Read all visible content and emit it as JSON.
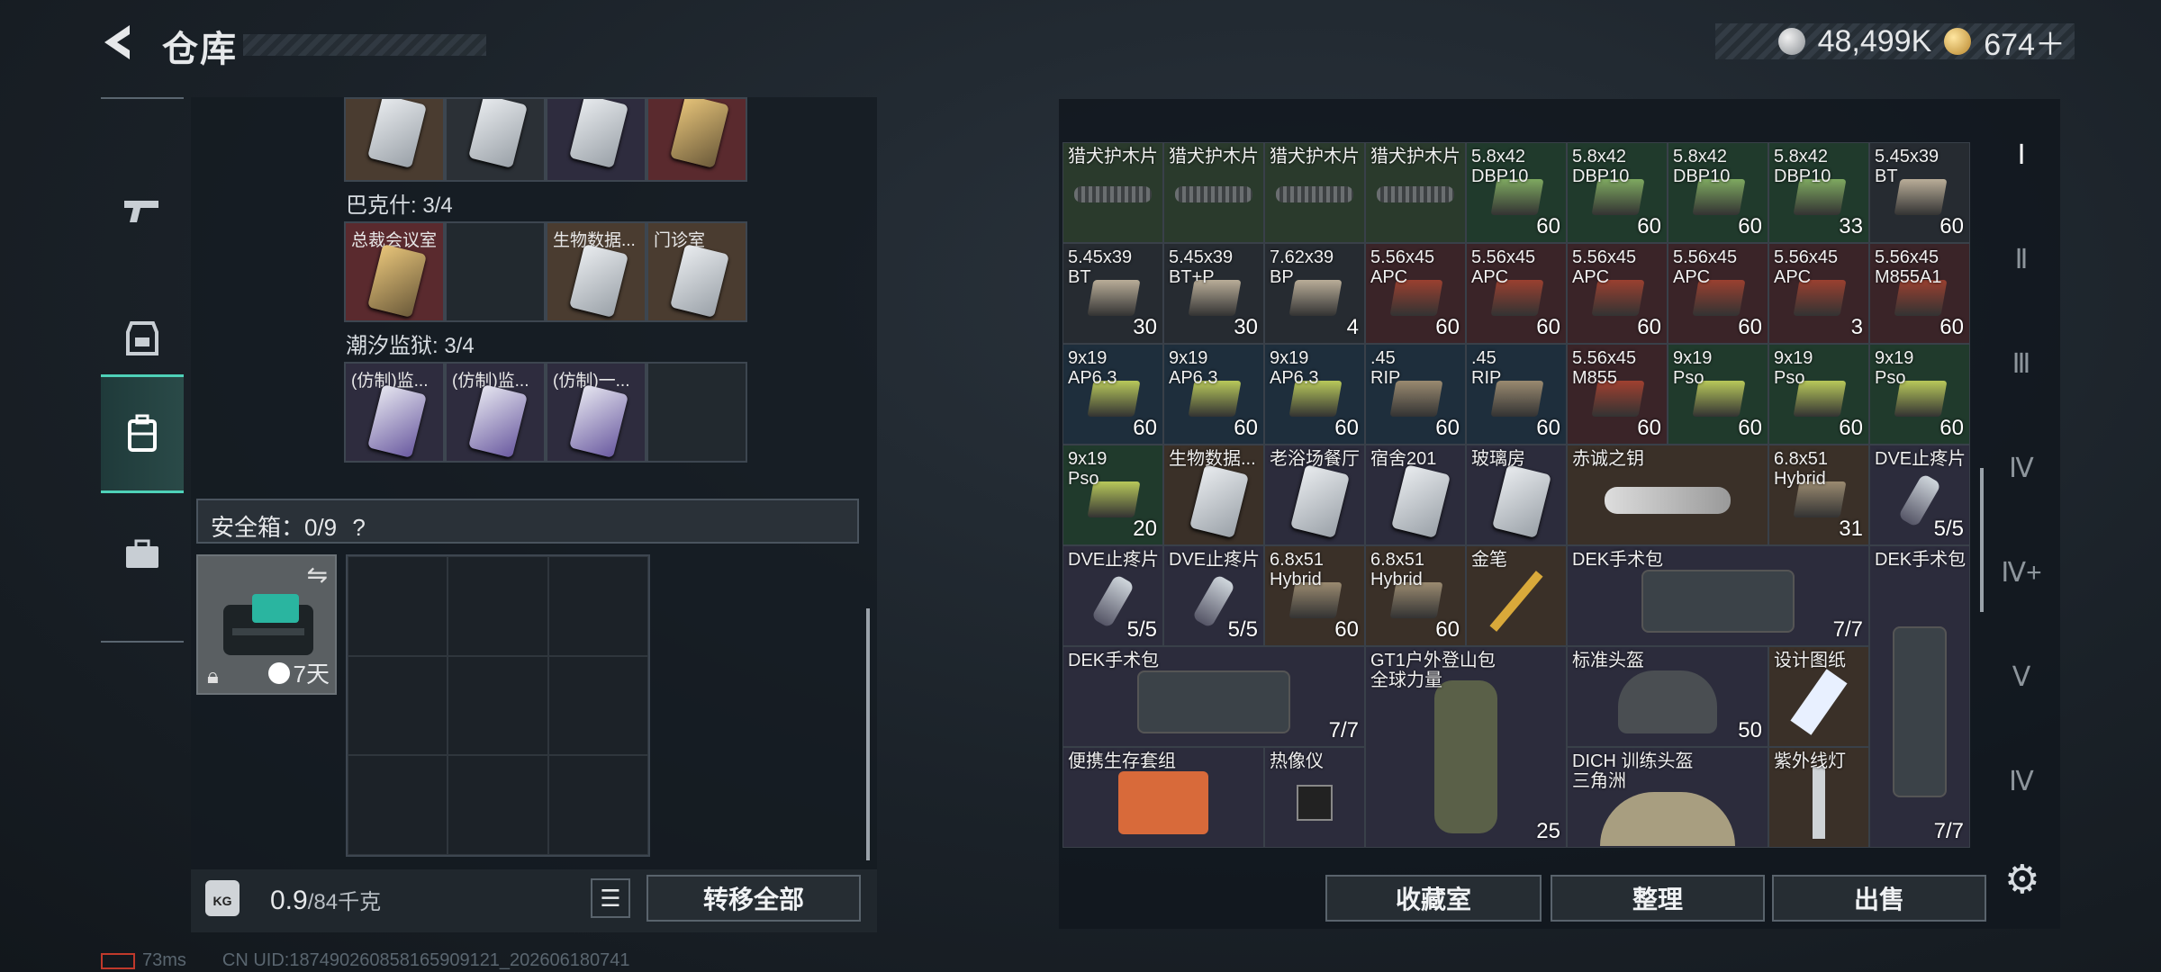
{
  "header": {
    "title": "仓库",
    "silver": "48,499K",
    "gold": "674＋"
  },
  "side_tabs": [
    {
      "name": "weapon-icon",
      "glyph": "⌐"
    },
    {
      "name": "armor-icon",
      "glyph": "⛨"
    },
    {
      "name": "backpack-icon",
      "glyph": "▤"
    },
    {
      "name": "toolbox-icon",
      "glyph": "⧉"
    }
  ],
  "left": {
    "section_bakeshi": "巴克什: 3/4",
    "section_prison": "潮汐监狱: 3/4",
    "row2": [
      "总裁会议室",
      "",
      "生物数据...",
      "门诊室"
    ],
    "row3": [
      "(仿制)监...",
      "(仿制)监...",
      "(仿制)一...",
      ""
    ],
    "safe_label": "安全箱：0/9",
    "safe_help": "?",
    "safe_timer": "7天",
    "weight": "0.9",
    "weight_max": "/84千克",
    "kg_icon": "KG",
    "transfer_all": "转移全部"
  },
  "inventory": {
    "row1": [
      {
        "n": "猎犬护木片",
        "c": ""
      },
      {
        "n": "猎犬护木片",
        "c": ""
      },
      {
        "n": "猎犬护木片",
        "c": ""
      },
      {
        "n": "猎犬护木片",
        "c": ""
      },
      {
        "n": "5.8x42\nDBP10",
        "c": "60"
      },
      {
        "n": "5.8x42\nDBP10",
        "c": "60"
      },
      {
        "n": "5.8x42\nDBP10",
        "c": "60"
      },
      {
        "n": "5.8x42\nDBP10",
        "c": "33"
      },
      {
        "n": "5.45x39\nBT",
        "c": "60"
      }
    ],
    "row2": [
      {
        "n": "5.45x39\nBT",
        "c": "30"
      },
      {
        "n": "5.45x39\nBT+P",
        "c": "30"
      },
      {
        "n": "7.62x39\nBP",
        "c": "4"
      },
      {
        "n": "5.56x45\nAPC",
        "c": "60"
      },
      {
        "n": "5.56x45\nAPC",
        "c": "60"
      },
      {
        "n": "5.56x45\nAPC",
        "c": "60"
      },
      {
        "n": "5.56x45\nAPC",
        "c": "60"
      },
      {
        "n": "5.56x45\nAPC",
        "c": "3"
      },
      {
        "n": "5.56x45\nM855A1",
        "c": "60"
      }
    ],
    "row3": [
      {
        "n": "9x19\nAP6.3",
        "c": "60"
      },
      {
        "n": "9x19\nAP6.3",
        "c": "60"
      },
      {
        "n": "9x19\nAP6.3",
        "c": "60"
      },
      {
        "n": ".45\nRIP",
        "c": "60"
      },
      {
        "n": ".45\nRIP",
        "c": "60"
      },
      {
        "n": "5.56x45\nM855",
        "c": "60"
      },
      {
        "n": "9x19\nPso",
        "c": "60"
      },
      {
        "n": "9x19\nPso",
        "c": "60"
      },
      {
        "n": "9x19\nPso",
        "c": "60"
      }
    ],
    "row4": [
      {
        "n": "9x19\nPso",
        "c": "20"
      },
      {
        "n": "生物数据...",
        "c": ""
      },
      {
        "n": "老浴场餐厅",
        "c": ""
      },
      {
        "n": "宿舍201",
        "c": ""
      },
      {
        "n": "玻璃房",
        "c": ""
      },
      {
        "n": "赤诚之钥",
        "c": ""
      },
      {
        "n": "6.8x51\nHybrid",
        "c": "31"
      },
      {
        "n": "DVE止疼片",
        "c": "5/5"
      }
    ],
    "row5": [
      {
        "n": "DVE止疼片",
        "c": "5/5"
      },
      {
        "n": "DVE止疼片",
        "c": "5/5"
      },
      {
        "n": "6.8x51\nHybrid",
        "c": "60"
      },
      {
        "n": "6.8x51\nHybrid",
        "c": "60"
      },
      {
        "n": "金笔",
        "c": ""
      },
      {
        "n": "DEK手术包",
        "c": "7/7"
      },
      {
        "n": "DEK手术包",
        "c": "7/7"
      }
    ],
    "row6": [
      {
        "n": "DEK手术包",
        "c": "7/7"
      },
      {
        "n": "GT1户外登山包\n全球力量",
        "c": "25"
      },
      {
        "n": "标准头盔",
        "c": "50"
      },
      {
        "n": "设计图纸",
        "c": ""
      }
    ],
    "row7": [
      {
        "n": "便携生存套组",
        "c": ""
      },
      {
        "n": "热像仪",
        "c": ""
      },
      {
        "n": "DICH 训练头盔\n三角洲",
        "c": ""
      },
      {
        "n": "紫外线灯",
        "c": ""
      }
    ]
  },
  "actions": {
    "collection": "收藏室",
    "sort": "整理",
    "sell": "出售"
  },
  "right_tabs": [
    "Ⅰ",
    "Ⅱ",
    "Ⅲ",
    "Ⅳ",
    "Ⅳ+",
    "Ⅴ",
    "Ⅳ"
  ],
  "status": {
    "ping": "73ms",
    "uid": "CN UID:1874902608581659091​21_202606180741"
  }
}
